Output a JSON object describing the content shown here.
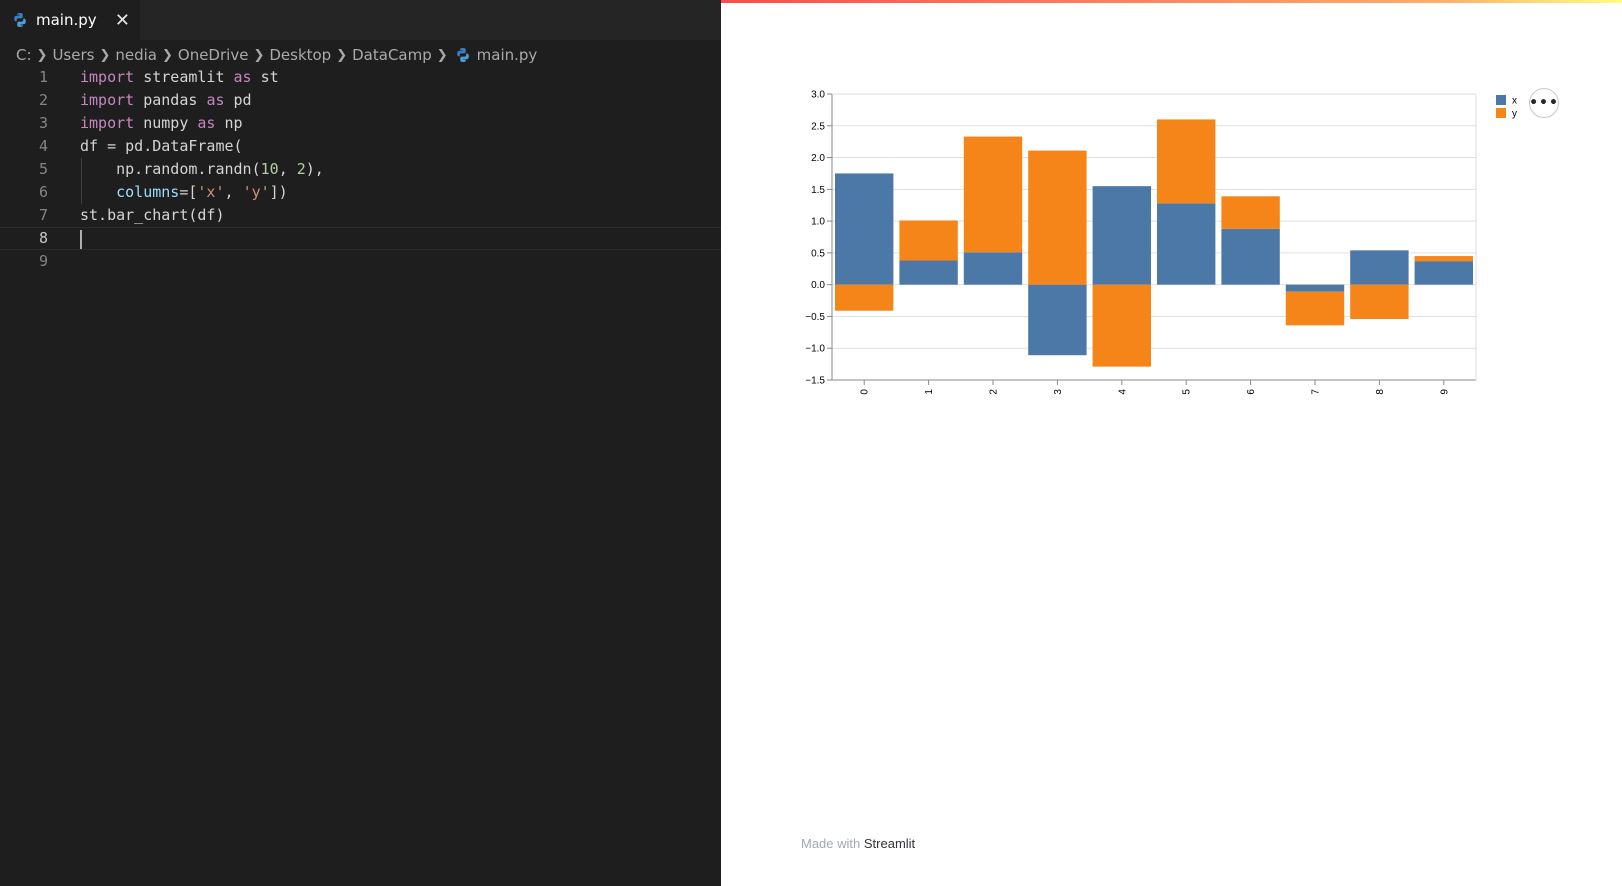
{
  "editor": {
    "tab": {
      "label": "main.py",
      "close": "✕"
    },
    "breadcrumb": [
      "C:",
      "Users",
      "nedia",
      "OneDrive",
      "Desktop",
      "DataCamp",
      "main.py"
    ],
    "lines": [
      {
        "n": "1",
        "code": "import streamlit as st"
      },
      {
        "n": "2",
        "code": "import pandas as pd"
      },
      {
        "n": "3",
        "code": "import numpy as np"
      },
      {
        "n": "4",
        "code": "df = pd.DataFrame("
      },
      {
        "n": "5",
        "code": "    np.random.randn(10, 2),"
      },
      {
        "n": "6",
        "code": "    columns=['x', 'y'])"
      },
      {
        "n": "7",
        "code": "st.bar_chart(df)"
      },
      {
        "n": "8",
        "code": ""
      },
      {
        "n": "9",
        "code": ""
      }
    ],
    "current_line": "8"
  },
  "app": {
    "menu_button": "•••",
    "footer": {
      "prefix": "Made with ",
      "brand": "Streamlit"
    }
  },
  "chart_data": {
    "type": "bar",
    "stacked": true,
    "categories": [
      "0",
      "1",
      "2",
      "3",
      "4",
      "5",
      "6",
      "7",
      "8",
      "9"
    ],
    "series": [
      {
        "name": "x",
        "color": "#4c78a8",
        "values": [
          1.75,
          0.38,
          0.51,
          -1.11,
          1.55,
          1.28,
          0.88,
          -0.11,
          0.54,
          0.37
        ]
      },
      {
        "name": "y",
        "color": "#f58518",
        "values": [
          -0.41,
          0.63,
          1.82,
          2.11,
          -1.29,
          1.32,
          0.51,
          -0.53,
          -0.54,
          0.08
        ]
      }
    ],
    "ylim": [
      -1.5,
      3.0
    ],
    "yticks": [
      "3.0",
      "2.5",
      "2.0",
      "1.5",
      "1.0",
      "0.5",
      "0.0",
      "−0.5",
      "−1.0",
      "−1.5"
    ],
    "ytick_values": [
      3.0,
      2.5,
      2.0,
      1.5,
      1.0,
      0.5,
      0.0,
      -0.5,
      -1.0,
      -1.5
    ],
    "grid": true,
    "legend": "top-right",
    "title": "",
    "xlabel": "",
    "ylabel": ""
  }
}
